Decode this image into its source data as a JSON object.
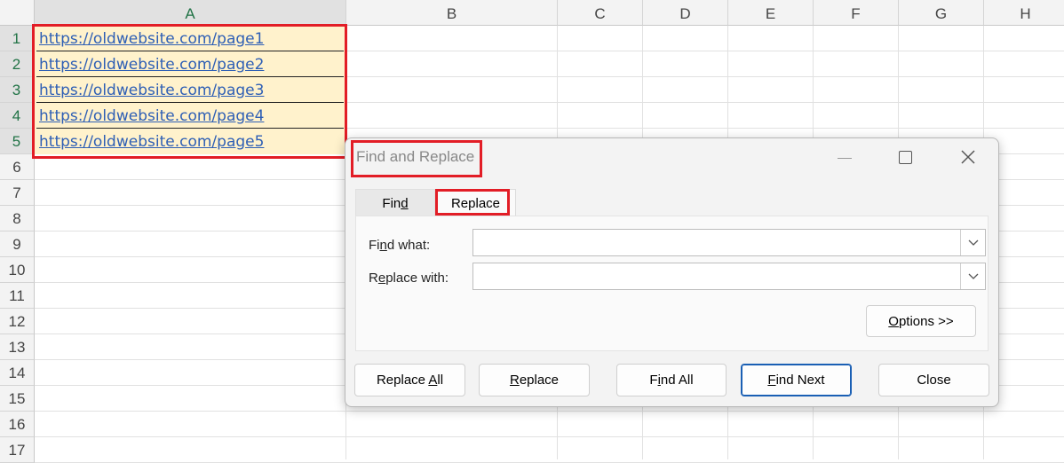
{
  "spreadsheet": {
    "columns": [
      "A",
      "B",
      "C",
      "D",
      "E",
      "F",
      "G",
      "H"
    ],
    "rows": [
      "1",
      "2",
      "3",
      "4",
      "5",
      "6",
      "7",
      "8",
      "9",
      "10",
      "11",
      "12",
      "13",
      "14",
      "15",
      "16",
      "17"
    ],
    "cells_a": [
      "https://oldwebsite.com/page1",
      "https://oldwebsite.com/page2",
      "https://oldwebsite.com/page3",
      "https://oldwebsite.com/page4",
      "https://oldwebsite.com/page5"
    ],
    "selected_column": "A",
    "selection_fill": "#fff2cc",
    "hyperlink_color": "#2e5fb5",
    "highlight_color": "#e21d26"
  },
  "dialog": {
    "title": "Find and Replace",
    "tabs": {
      "find": "Find",
      "replace": "Replace"
    },
    "active_tab": "Replace",
    "find_what_label": "Find what:",
    "find_what_value": "",
    "replace_with_label": "Replace with:",
    "replace_with_value": "",
    "options_button": "Options >>",
    "buttons": {
      "replace_all": "Replace All",
      "replace": "Replace",
      "find_all": "Find All",
      "find_next": "Find Next",
      "close": "Close"
    }
  }
}
